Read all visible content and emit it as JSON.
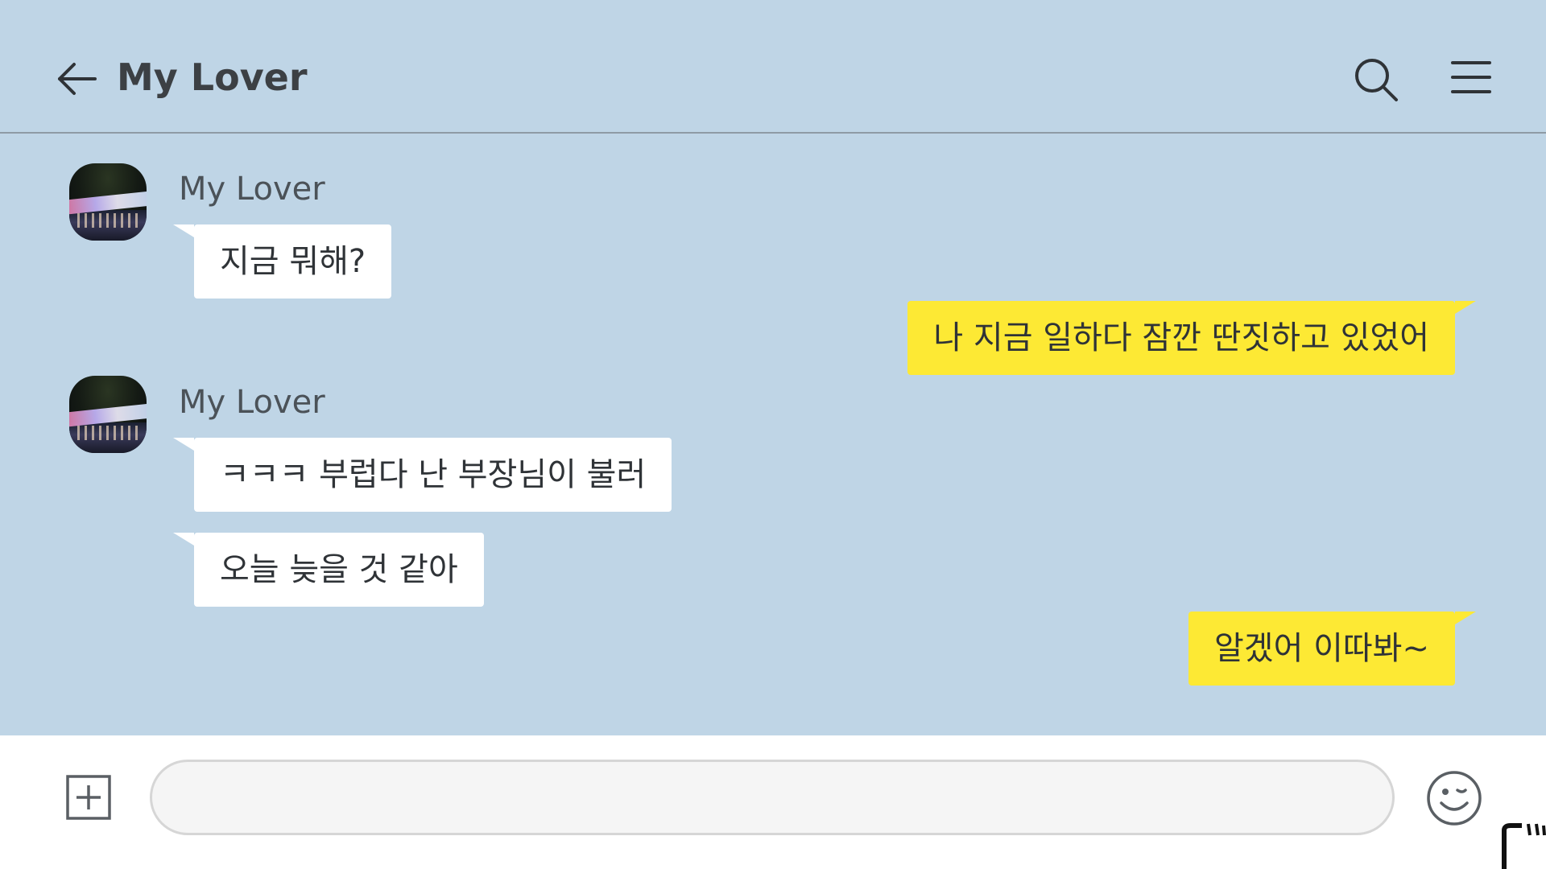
{
  "header": {
    "title": "My Lover",
    "back_icon": "arrow-left-icon",
    "search_icon": "search-icon",
    "menu_icon": "hamburger-menu-icon"
  },
  "messages": [
    {
      "direction": "incoming",
      "sender": "My Lover",
      "bubbles": [
        "지금 뭐해?"
      ]
    },
    {
      "direction": "outgoing",
      "bubbles": [
        "나 지금 일하다 잠깐 딴짓하고 있었어"
      ]
    },
    {
      "direction": "incoming",
      "sender": "My Lover",
      "bubbles": [
        "ㅋㅋㅋ 부럽다 난 부장님이 불러",
        "오늘 늦을 것 같아"
      ]
    },
    {
      "direction": "outgoing",
      "bubbles": [
        "알겠어 이따봐~"
      ]
    }
  ],
  "input_bar": {
    "add_icon": "plus-square-icon",
    "message_value": "",
    "emoji_icon": "smiley-emoji-icon"
  },
  "colors": {
    "chat_background": "#bfd5e6",
    "outgoing_bubble": "#fde934",
    "incoming_bubble": "#ffffff",
    "text": "#2f3337"
  }
}
